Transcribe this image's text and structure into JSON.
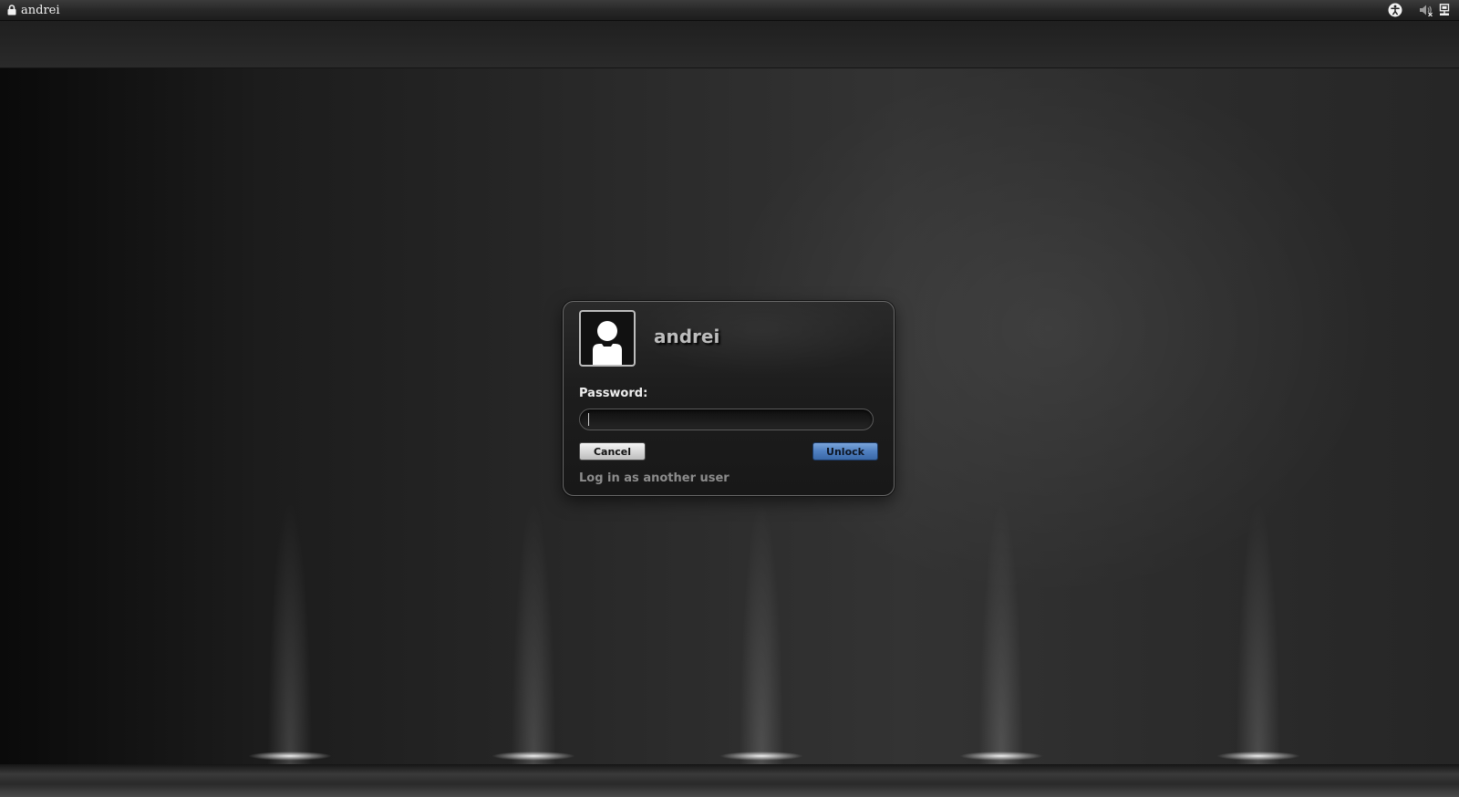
{
  "top_panel": {
    "username": "andrei",
    "left_icon": "lock-icon",
    "right_icons": [
      "accessibility-icon",
      "volume-icon",
      "network-icon"
    ]
  },
  "dialog": {
    "username": "andrei",
    "avatar_icon": "user-silhouette-icon",
    "password_label": "Password:",
    "password_value": "",
    "cancel_label": "Cancel",
    "unlock_label": "Unlock",
    "other_user_label": "Log in as another user"
  },
  "colors": {
    "unlock_accent": "#4f7fc0",
    "panel_bg": "#262626",
    "dialog_bg": "#1d1d1d"
  }
}
